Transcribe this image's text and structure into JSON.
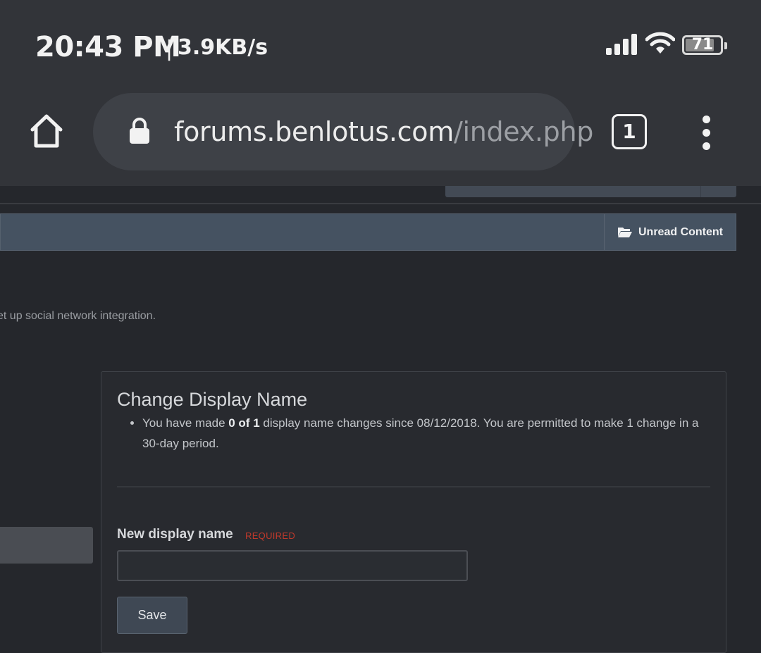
{
  "status_bar": {
    "time": "20:43 PM",
    "separator": "|",
    "net_speed": "3.9KB/s",
    "signal_icon": "signal-bars-icon",
    "wifi_icon": "wifi-icon",
    "battery_level": "71"
  },
  "browser": {
    "home_icon": "home-icon",
    "lock_icon": "lock-icon",
    "url_host": "forums.benlotus.com",
    "url_path": "/index.php",
    "tab_count": "1",
    "menu_icon": "vertical-dots-icon"
  },
  "nav": {
    "unread_label": "Unread Content",
    "unread_icon": "folder-open-icon"
  },
  "page": {
    "intro_text": "et up social network integration."
  },
  "panel": {
    "title": "Change Display Name",
    "info_prefix": "You have made ",
    "info_count": "0 of 1",
    "info_suffix": " display name changes since 08/12/2018. You are permitted to make 1 change in a 30-day period.",
    "field_label": "New display name",
    "required_label": "REQUIRED",
    "input_value": "",
    "save_label": "Save"
  },
  "colors": {
    "background": "#25272c",
    "chrome": "#323439",
    "nav_bar": "#455261",
    "required": "#c0392b"
  }
}
